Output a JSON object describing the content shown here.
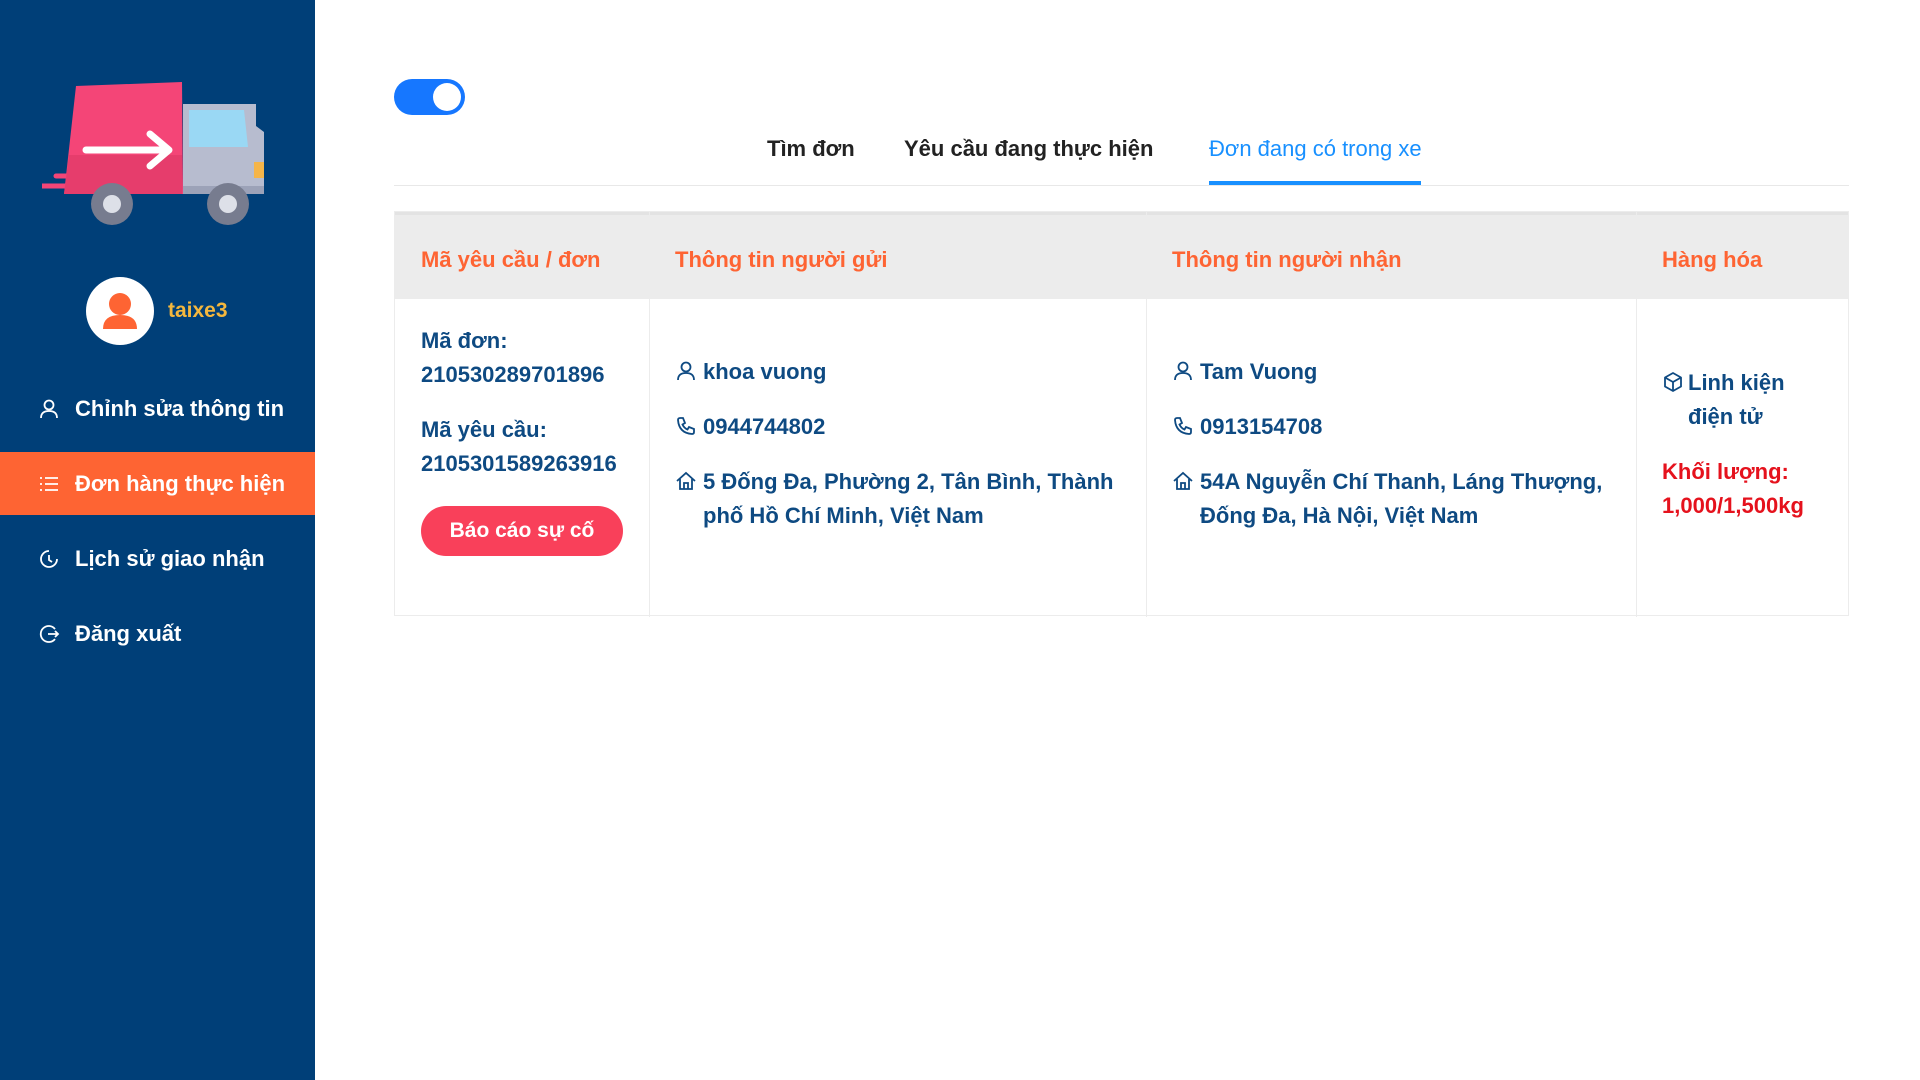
{
  "user": {
    "name": "taixe3"
  },
  "menu": [
    {
      "label": "Chỉnh sửa thông tin",
      "icon": "user-icon"
    },
    {
      "label": "Đơn hàng thực hiện",
      "icon": "list-icon",
      "active": true
    },
    {
      "label": "Lịch sử giao nhận",
      "icon": "history-icon"
    },
    {
      "label": "Đăng xuất",
      "icon": "logout-icon"
    }
  ],
  "tabs": [
    {
      "label": "Tìm đơn"
    },
    {
      "label": "Yêu cầu đang thực hiện"
    },
    {
      "label": "Đơn đang có trong xe",
      "active": true
    }
  ],
  "table": {
    "headers": [
      "Mã yêu cầu / đơn",
      "Thông tin người gửi",
      "Thông tin người nhận",
      "Hàng hóa"
    ],
    "row": {
      "order_label": "Mã đơn:",
      "order_id": "210530289701896",
      "request_label": "Mã yêu cầu:",
      "request_id": "2105301589263916",
      "report_button": "Báo cáo sự cố",
      "sender": {
        "name": "khoa vuong",
        "phone": "0944744802",
        "address": "5 Đống Đa, Phường 2, Tân Bình, Thành phố Hồ Chí Minh, Việt Nam"
      },
      "receiver": {
        "name": "Tam Vuong",
        "phone": "0913154708",
        "address": "54A Nguyễn Chí Thanh, Láng Thượng, Đống Đa, Hà Nội, Việt Nam"
      },
      "goods": {
        "name": "Linh kiện điện tử",
        "weight_label": "Khối lượng:",
        "weight_value": "1,000/1,500kg"
      }
    }
  },
  "colors": {
    "sidebar": "#003f78",
    "accent": "#fe6433",
    "primary": "#1890ff",
    "danger": "#f9405a",
    "username": "#f4b73d"
  }
}
